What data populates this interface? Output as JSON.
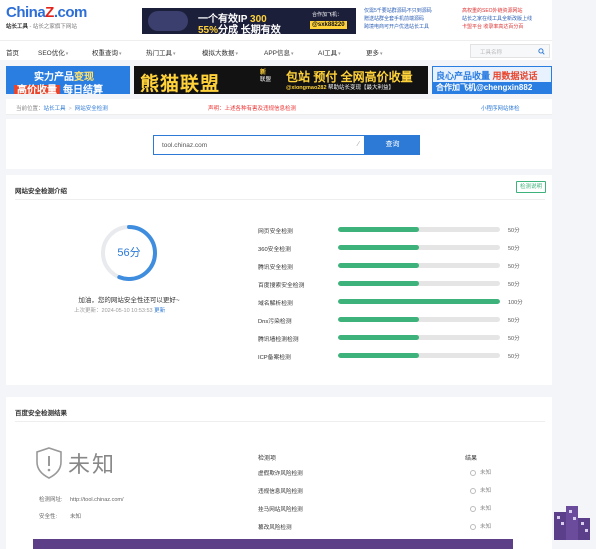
{
  "header": {
    "logo_main_a": "China",
    "logo_main_z": "Z",
    "logo_main_b": ".com",
    "logo_sub_bold": "站长工具",
    "logo_sub_rest": "  -  站长之家旗下网站",
    "ad": {
      "line1_a": "一个有效IP ",
      "line1_b": "300",
      "line2_a": "55%",
      "line2_b": "分成 长期有效",
      "tag1": "合作加飞机：",
      "tag2": "@sxk88220"
    },
    "links_a": [
      "仅需5千要站群源码不只到源码",
      "赠送站群全套手机前端源码",
      "跨境电商可开户优选站长工具"
    ],
    "links_b": [
      "高权重的SEO外链资源网站",
      "站长之家在线工具全新改版上线",
      "卡盟平台 收录率高达百分百"
    ]
  },
  "nav": {
    "items": [
      {
        "label": "首页",
        "caret": false
      },
      {
        "label": "SEO优化",
        "caret": true
      },
      {
        "label": "权重查询",
        "caret": true
      },
      {
        "label": "热门工具",
        "caret": true
      },
      {
        "label": "模拟大数据",
        "caret": true
      },
      {
        "label": "APP信息",
        "caret": true
      },
      {
        "label": "AI工具",
        "caret": true
      },
      {
        "label": "更多",
        "caret": true
      }
    ],
    "search_placeholder": "工具名称"
  },
  "banners": {
    "b1_line1_a": "实力产品",
    "b1_line1_b": "变现",
    "b1_line2_tag": "高价收量",
    "b1_line2_rest": "每日结算",
    "b2_big": "熊猫联盟",
    "b2_mid_a": "新",
    "b2_mid_b": "联盟",
    "b2_right": "包站 预付 全网高价收量",
    "b2_right2_a": "@xiongmao282",
    "b2_right2_b": "  帮助站长变现【最大利益】",
    "b3_line1_a": "良心产品收量 ",
    "b3_line1_b": "用数据说话",
    "b3_line2": "合作加飞机@chengxin882"
  },
  "breadcrumb": {
    "prefix": "当前位置：",
    "items": [
      "站长工具",
      "网站安全检测"
    ],
    "middle": "声明：上述各种有害及违规信息检测",
    "right": "小程序网站体检"
  },
  "search": {
    "value": "tool.chinaz.com",
    "button": "查询"
  },
  "overview": {
    "title": "网站安全检测介绍",
    "button": "检测说明",
    "score_label": "56分",
    "score": 56,
    "verdict": "加油，您的网站安全性还可以更好~",
    "updated_prefix": "上次更新：",
    "updated_time": "2024-05-10 10:53:53",
    "updated_link": "更新",
    "metrics": [
      {
        "label": "网页安全检测",
        "percent": 50,
        "value": "50分"
      },
      {
        "label": "360安全检测",
        "percent": 50,
        "value": "50分"
      },
      {
        "label": "腾讯安全检测",
        "percent": 50,
        "value": "50分"
      },
      {
        "label": "百度搜索安全检测",
        "percent": 50,
        "value": "50分"
      },
      {
        "label": "域名解析检测",
        "percent": 100,
        "value": "100分"
      },
      {
        "label": "Dns污染检测",
        "percent": 50,
        "value": "50分"
      },
      {
        "label": "腾讯墙检测检测",
        "percent": 50,
        "value": "50分"
      },
      {
        "label": "ICP备案检测",
        "percent": 50,
        "value": "50分"
      }
    ]
  },
  "results": {
    "title": "百度安全检测结果",
    "status_big": "未知",
    "domain_key": "检测网址:",
    "domain_val": "http://tool.chinaz.com/",
    "safe_key": "安全性:",
    "safe_val": "未知",
    "col_item": "检测项",
    "col_result": "结果",
    "rows": [
      {
        "label": "虚假欺诈风险检测",
        "status": "未知"
      },
      {
        "label": "违规信息风险检测",
        "status": "未知"
      },
      {
        "label": "挂马网站风险检测",
        "status": "未知"
      },
      {
        "label": "篡改风险检测",
        "status": "未知"
      }
    ]
  }
}
